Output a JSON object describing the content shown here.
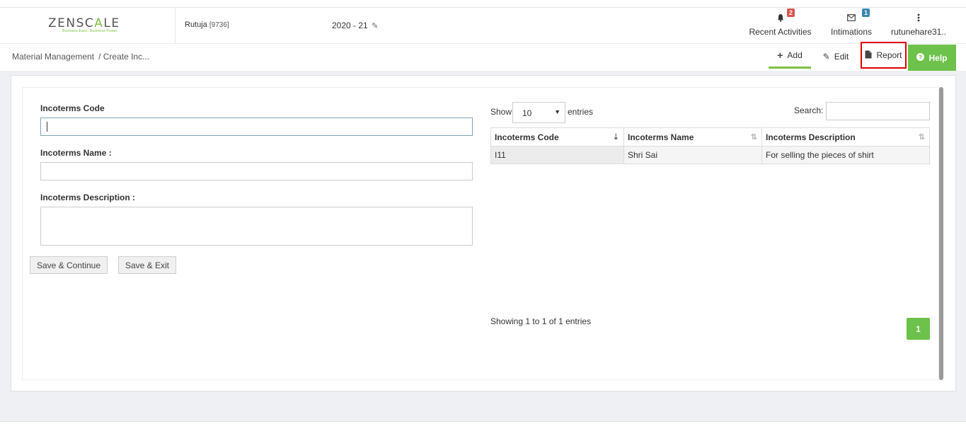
{
  "header": {
    "logo_prefix": "ZENSC",
    "logo_accent": "A",
    "logo_suffix": "LE",
    "logo_tagline": "Business Ease, Business Power.",
    "user_name": "Rutuja",
    "user_id": "[9736]",
    "fiscal_year": "2020 - 21",
    "recent_activities": {
      "label": "Recent Activities",
      "badge": "2"
    },
    "intimations": {
      "label": "Intimations",
      "badge": "1"
    },
    "account": {
      "label": "rutunehare31.."
    }
  },
  "breadcrumb": {
    "module": "Material Management",
    "page": "/ Create Inc..."
  },
  "actions": {
    "add": "Add",
    "edit": "Edit",
    "report": "Report",
    "help": "Help"
  },
  "form": {
    "code_label": "Incoterms Code",
    "code_value": "",
    "name_label": "Incoterms Name :",
    "name_value": "",
    "desc_label": "Incoterms Description :",
    "desc_value": "",
    "save_continue": "Save & Continue",
    "save_exit": "Save & Exit"
  },
  "table": {
    "show_label": "Show",
    "page_length": "10",
    "entries_label": "entries",
    "search_label": "Search:",
    "search_value": "",
    "columns": [
      "Incoterms Code",
      "Incoterms Name",
      "Incoterms Description"
    ],
    "rows": [
      [
        "I11",
        "Shri Sai",
        "For selling the pieces of shirt"
      ]
    ],
    "info": "Showing 1 to 1 of 1 entries",
    "current_page": "1"
  },
  "colors": {
    "accent_green": "#6cc24a",
    "highlight_red": "#e00000",
    "badge_red": "#d9534f",
    "badge_blue": "#3a87ad"
  }
}
